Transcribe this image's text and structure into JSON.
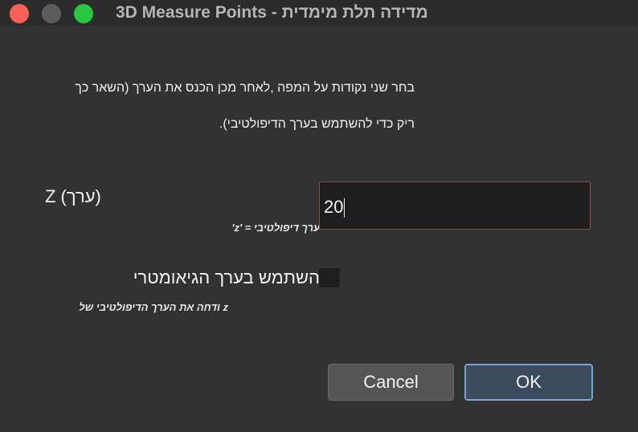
{
  "window": {
    "title": "3D Measure Points - מדידה תלת מימדית"
  },
  "instructions": {
    "line1": "בחר שני נקודות על המפה ,לאחר מכן הכנס את הערך (השאר כך",
    "line2": "ריק כדי להשתמש בערך הדיפולטיבי)."
  },
  "z_field": {
    "label": "Z (ערך)",
    "hint": "ערך דיפולטיבי = 'z'",
    "value": "20"
  },
  "geometric_option": {
    "label": "השתמש בערך הגיאומטרי",
    "hint": "z ודחה את הערך הדיפולטיבי של",
    "checked": false
  },
  "buttons": {
    "cancel": "Cancel",
    "ok": "OK"
  },
  "colors": {
    "close": "#fe5f57",
    "minimize": "#5c5c5c",
    "zoom": "#28c840",
    "focus_ring": "#7aa2d6"
  }
}
